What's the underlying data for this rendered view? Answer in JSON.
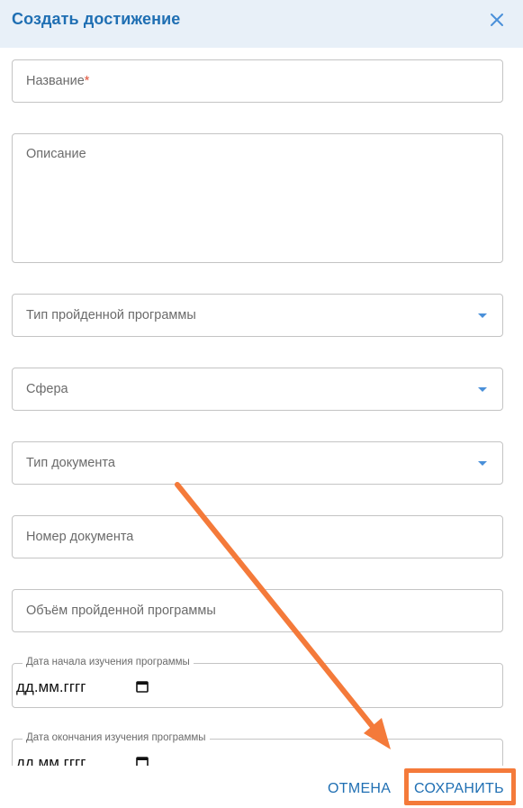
{
  "dialog": {
    "title": "Создать достижение"
  },
  "form": {
    "name": {
      "placeholder": "Название",
      "required_mark": "*"
    },
    "description": {
      "placeholder": "Описание"
    },
    "program_type": {
      "placeholder": "Тип пройденной программы"
    },
    "sphere": {
      "placeholder": "Сфера"
    },
    "document_type": {
      "placeholder": "Тип документа"
    },
    "document_number": {
      "placeholder": "Номер документа"
    },
    "program_volume": {
      "placeholder": "Объём пройденной программы"
    },
    "start_date": {
      "label": "Дата начала изучения программы",
      "value": "дд.мм.гггг"
    },
    "end_date": {
      "label": "Дата окончания изучения программы",
      "value": "дд.мм.гггг"
    }
  },
  "footer": {
    "cancel_label": "ОТМЕНА",
    "save_label": "СОХРАНИТЬ"
  },
  "colors": {
    "accent": "#1f6fb3",
    "header_bg": "#e8f0f8",
    "annotation": "#f47a3a"
  },
  "icons": {
    "close": "close-icon",
    "dropdown": "chevron-down-icon",
    "calendar": "calendar-icon"
  }
}
